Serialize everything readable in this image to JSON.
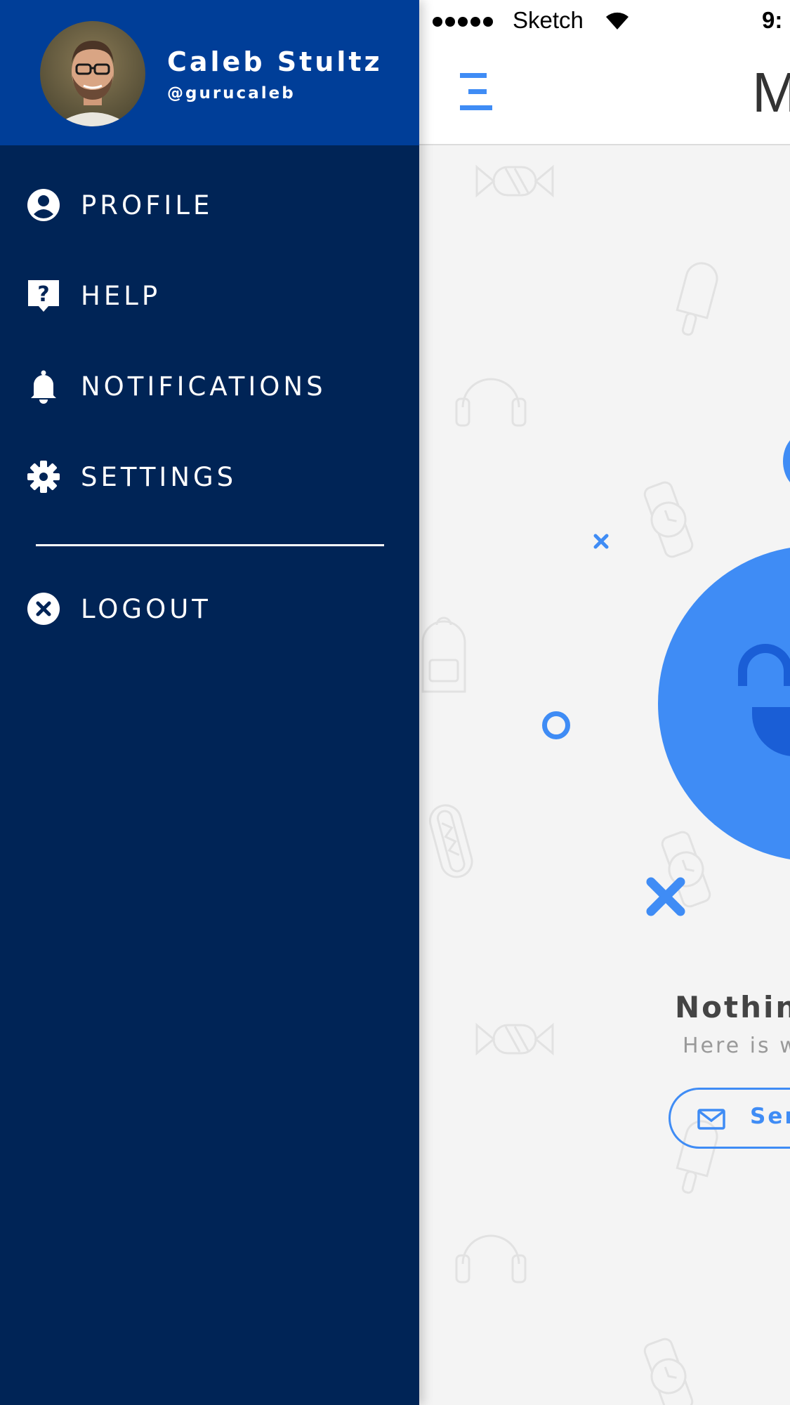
{
  "colors": {
    "drawer_bg": "#002456",
    "drawer_header_bg": "#003e98",
    "accent": "#3f8cf5",
    "accent_dark": "#1a5ed6",
    "main_bg": "#f4f4f4"
  },
  "status_bar": {
    "carrier": "Sketch",
    "time": "9:",
    "signal_icon": "signal-dots-icon",
    "wifi_icon": "wifi-icon"
  },
  "navbar": {
    "menu_icon": "hamburger-menu-icon",
    "title": "M"
  },
  "user": {
    "name": "Caleb Stultz",
    "handle": "@gurucaleb",
    "avatar_icon": "avatar-photo"
  },
  "menu": {
    "items": [
      {
        "label": "PROFILE",
        "icon": "profile-icon"
      },
      {
        "label": "HELP",
        "icon": "help-icon"
      },
      {
        "label": "NOTIFICATIONS",
        "icon": "bell-icon"
      },
      {
        "label": "SETTINGS",
        "icon": "gear-icon"
      }
    ],
    "logout": {
      "label": "LOGOUT",
      "icon": "close-circle-icon"
    }
  },
  "empty_state": {
    "title": "Nothing",
    "subtitle": "Here is wh",
    "button_label": "Sen",
    "button_icon": "mail-icon"
  }
}
